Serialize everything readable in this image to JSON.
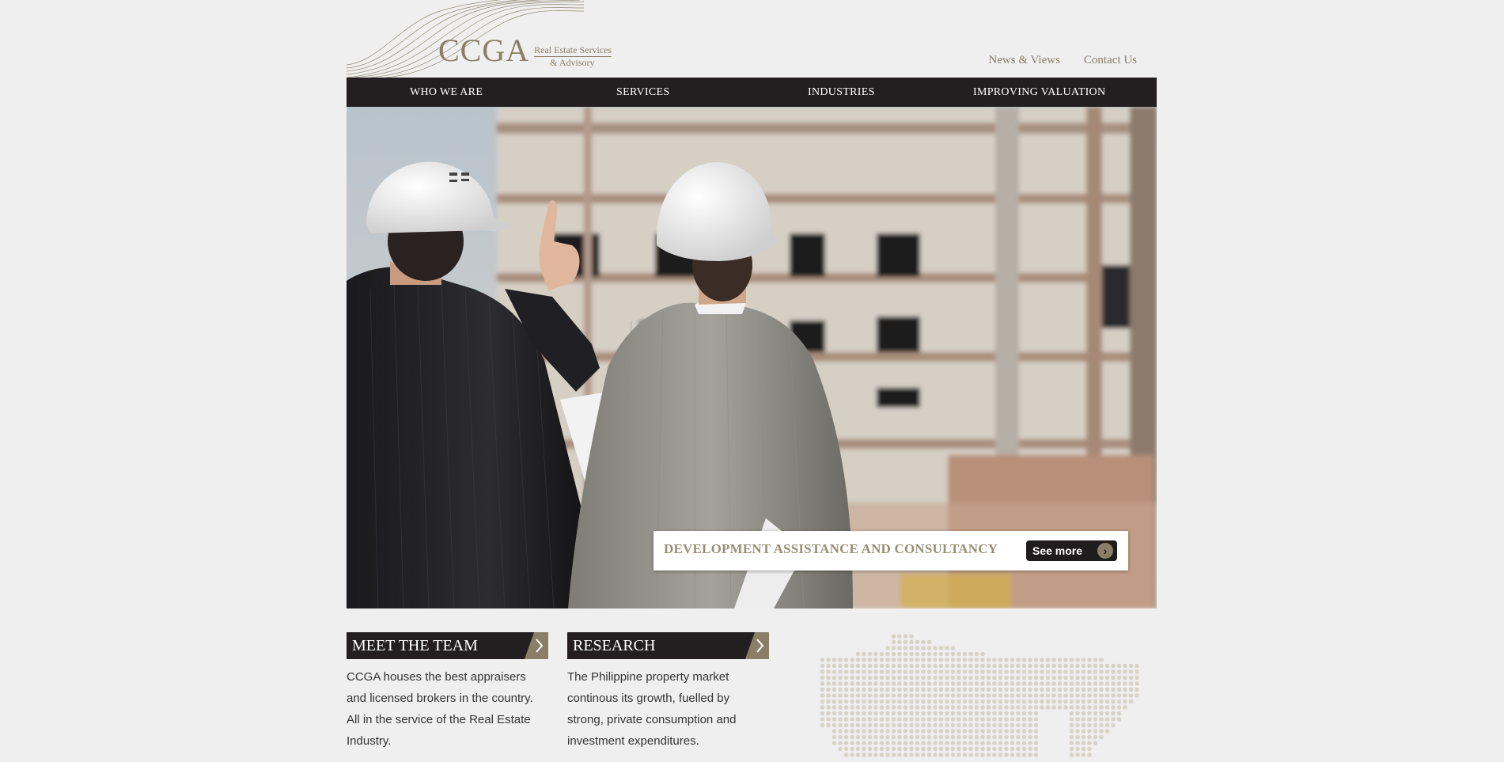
{
  "brand": {
    "name": "CCGA",
    "tagline_line1": "Real Estate Services",
    "tagline_line2": "& Advisory"
  },
  "top_links": [
    "News & Views",
    "Contact Us"
  ],
  "nav": [
    "WHO WE ARE",
    "SERVICES",
    "INDUSTRIES",
    "IMPROVING VALUATION"
  ],
  "hero": {
    "caption": "DEVELOPMENT ASSISTANCE AND CONSULTANCY",
    "button": "See more",
    "button_icon": "chevron-right-icon"
  },
  "panels": [
    {
      "title": "MEET THE TEAM",
      "text": "CCGA houses the best appraisers and licensed brokers in the country. All in the service of the Real Estate Industry."
    },
    {
      "title": "RESEARCH",
      "text": "The Philippine property market continous its growth, fuelled by strong, private consumption and investment expenditures."
    }
  ],
  "colors": {
    "background": "#efefef",
    "nav": "#231f20",
    "accent": "#8a7f66"
  }
}
